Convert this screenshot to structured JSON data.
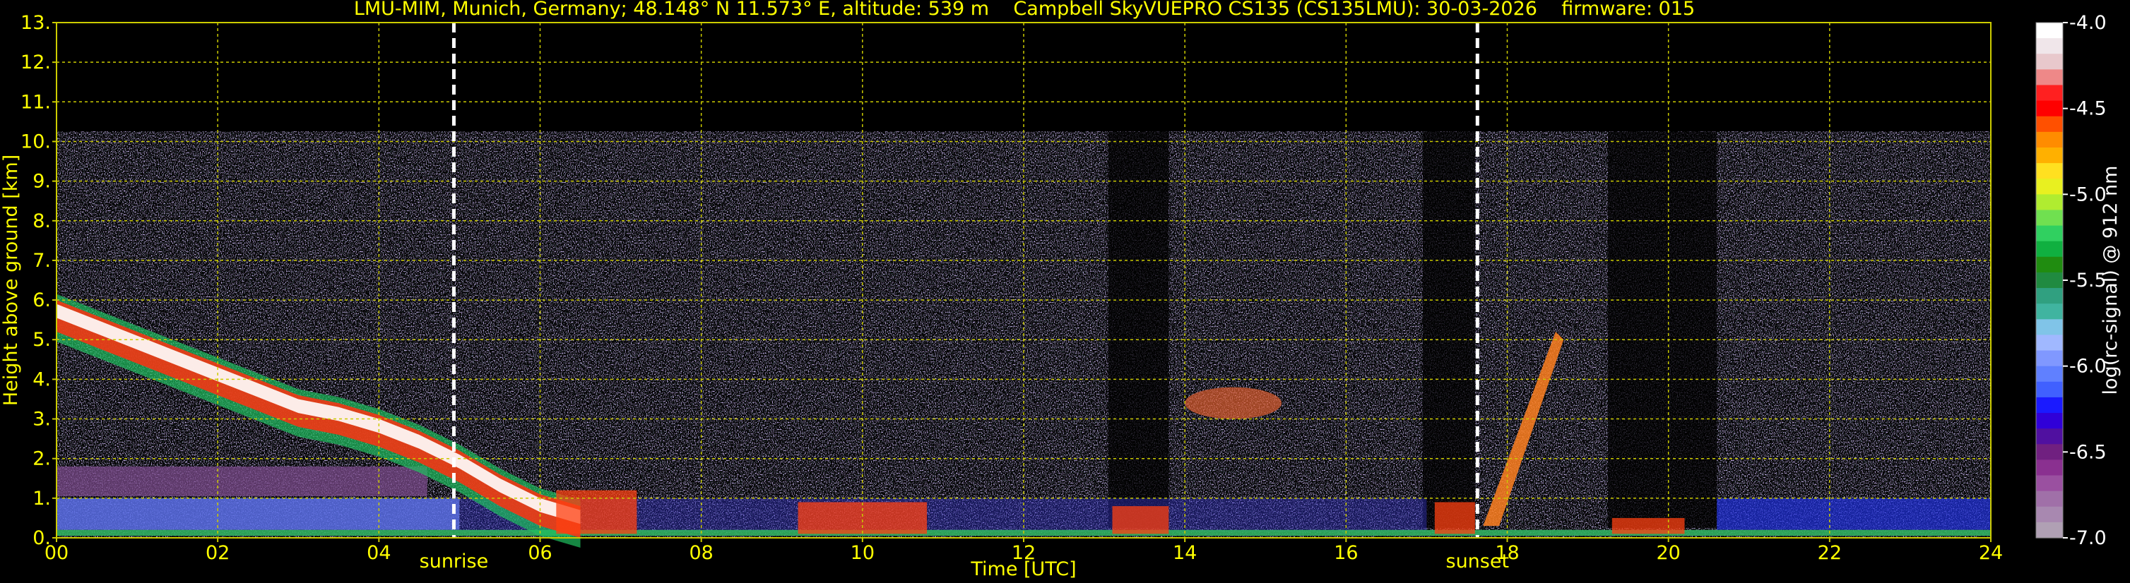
{
  "chart_data": {
    "type": "heatmap",
    "title": "LMU-MIM, Munich, Germany; 48.148° N 11.573° E, altitude: 539 m    Campbell SkyVUEPRO CS135 (CS135LMU): 30-03-2026    firmware: 015",
    "xlabel": "Time [UTC]",
    "ylabel": "Height above ground [km]",
    "colorbar_label": "log(rc-signal) @ 912 nm",
    "xlim": [
      0,
      24
    ],
    "ylim": [
      0,
      13
    ],
    "grid": true,
    "x_ticks": [
      0,
      2,
      4,
      6,
      8,
      10,
      12,
      14,
      16,
      18,
      20,
      22,
      24
    ],
    "x_tick_labels": [
      "00",
      "02",
      "04",
      "06",
      "08",
      "10",
      "12",
      "14",
      "16",
      "18",
      "20",
      "22",
      "24"
    ],
    "y_ticks": [
      0,
      1,
      2,
      3,
      4,
      5,
      6,
      7,
      8,
      9,
      10,
      11,
      12,
      13
    ],
    "y_tick_labels": [
      "0.",
      "1.",
      "2.",
      "3.",
      "4.",
      "5.",
      "6.",
      "7.",
      "8.",
      "9.",
      "10.",
      "11.",
      "12.",
      "13."
    ],
    "colorbar": {
      "range": [
        -7.0,
        -4.0
      ],
      "ticks": [
        -4.0,
        -4.5,
        -5.0,
        -5.5,
        -6.0,
        -6.5,
        -7.0
      ],
      "tick_labels": [
        "-4.0",
        "-4.5",
        "-5.0",
        "-5.5",
        "-6.0",
        "-6.5",
        "-7.0"
      ],
      "colors": [
        "#ffffff",
        "#f0e6ea",
        "#e8c8cc",
        "#ee8888",
        "#ff2020",
        "#ff0000",
        "#ff5000",
        "#ff8c00",
        "#ffb000",
        "#ffe020",
        "#e8f020",
        "#b0ec30",
        "#70e050",
        "#30d060",
        "#10b040",
        "#208c10",
        "#208a40",
        "#30a080",
        "#40b4a0",
        "#80c4e8",
        "#a0b8ff",
        "#8098ff",
        "#6080ff",
        "#4060ff",
        "#1a1aff",
        "#3000d8",
        "#5010a0",
        "#702080",
        "#8a3090",
        "#9a50a0",
        "#a070a8",
        "#a888b0",
        "#b0a0b4"
      ]
    },
    "events": [
      {
        "label": "sunrise",
        "x": 4.93
      },
      {
        "label": "sunset",
        "x": 17.63
      }
    ],
    "colors": {
      "text": "#ffff00",
      "grid": "#cccc00",
      "event_line": "#ffffff",
      "colorbar_label": "#ffffff"
    }
  }
}
